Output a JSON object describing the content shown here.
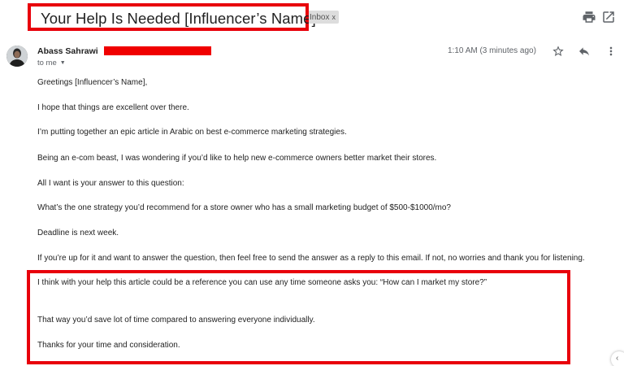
{
  "email": {
    "subject": "Your Help Is Needed [Influencer’s Name]",
    "label_chip": "Inbox",
    "label_chip_close": "x",
    "sender_name": "Abass Sahrawi",
    "recipient": "to me",
    "timestamp": "1:10 AM (3 minutes ago)",
    "body_lines": [
      "Greetings [Influencer’s Name],",
      "I hope that things are excellent over there.",
      "I’m putting together an epic article in Arabic on best e-commerce marketing strategies.",
      "Being an e-com beast, I was wondering if you’d like to help new e-commerce owners better market their stores.",
      "All I want is your answer to this question:",
      "What’s the one strategy you’d recommend for a store owner who has a small marketing budget of $500-$1000/mo?",
      "Deadline is next week.",
      "If you’re up for it and want to answer the question, then feel free to send the answer as a reply to this email. If not, no worries and thank you for listening.",
      "I think with your help this article could be a reference you can use any time someone asks you: “How can I market my store?”",
      "That way you’d save lot of time compared to answering everyone individually.",
      "Thanks for your time and consideration."
    ]
  },
  "icons": {
    "print": "print-icon",
    "open_in_new_window": "open-in-new-icon",
    "star": "star-icon",
    "reply": "reply-icon",
    "more": "more-vert-icon"
  },
  "colors": {
    "annotation_red": "#e8000b",
    "redaction_red": "#f00000",
    "muted_text": "#5f6368",
    "chip_bg": "#dddddd"
  }
}
